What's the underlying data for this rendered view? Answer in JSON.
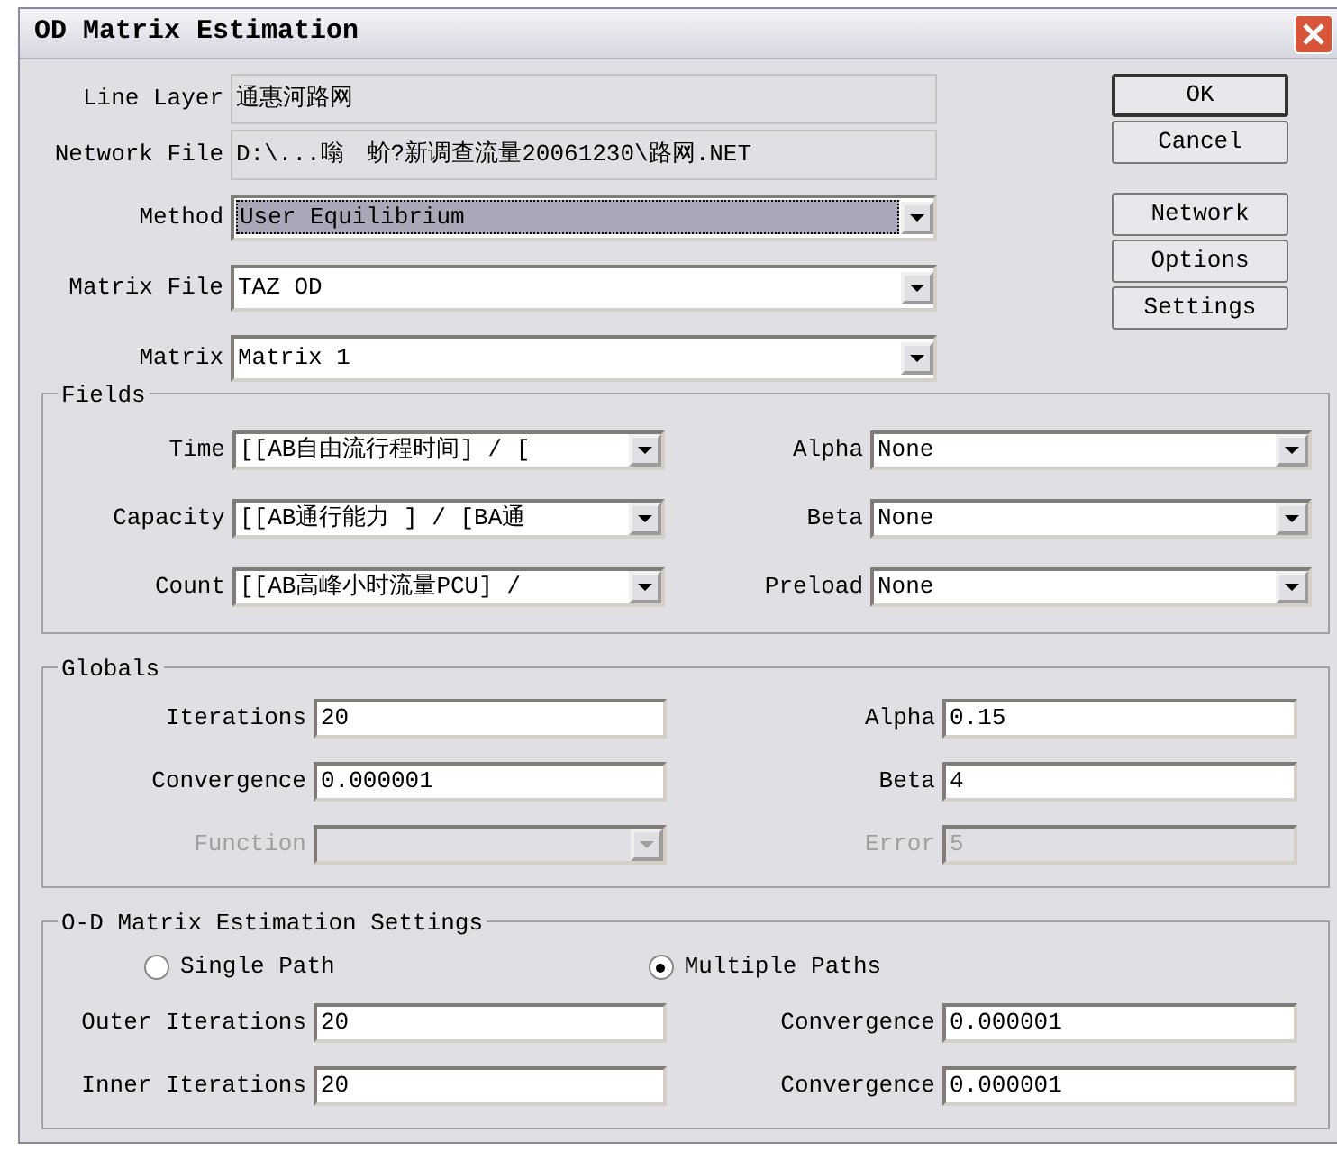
{
  "window": {
    "title": "OD Matrix Estimation"
  },
  "top_fields": [
    {
      "label": "Line Layer",
      "value": "通惠河路网",
      "kind": "readonly",
      "focused": false
    },
    {
      "label": "Network File",
      "value": "D:\\...嗡　蚧?新调查流量20061230\\路网.NET",
      "kind": "readonly",
      "focused": false
    },
    {
      "label": "Method",
      "value": "User Equilibrium",
      "kind": "combo",
      "focused": true
    },
    {
      "label": "Matrix File",
      "value": "TAZ OD",
      "kind": "combo",
      "focused": false
    },
    {
      "label": "Matrix",
      "value": "Matrix 1",
      "kind": "combo",
      "focused": false
    }
  ],
  "buttons": [
    {
      "label": "OK",
      "default": true
    },
    {
      "label": "Cancel",
      "default": false
    }
  ],
  "tool_buttons": [
    {
      "label": "Network"
    },
    {
      "label": "Options"
    },
    {
      "label": "Settings"
    }
  ],
  "fields": {
    "title": "Fields",
    "left": [
      {
        "label": "Time",
        "value": "[[AB自由流行程时间] / ["
      },
      {
        "label": "Capacity",
        "value": "[[AB通行能力 ] / [BA通"
      },
      {
        "label": "Count",
        "value": "[[AB高峰小时流量PCU] / "
      }
    ],
    "right": [
      {
        "label": "Alpha",
        "value": "None"
      },
      {
        "label": "Beta",
        "value": "None"
      },
      {
        "label": "Preload",
        "value": "None"
      }
    ]
  },
  "globals": {
    "title": "Globals",
    "left": [
      {
        "label": "Iterations",
        "value": "20",
        "kind": "input",
        "disabled": false
      },
      {
        "label": "Convergence",
        "value": "0.000001",
        "kind": "input",
        "disabled": false
      },
      {
        "label": "Function",
        "kind": "combo",
        "disabled": true
      }
    ],
    "right": [
      {
        "label": "Alpha",
        "value": "0.15",
        "disabled": false
      },
      {
        "label": "Beta",
        "value": "4",
        "disabled": false
      },
      {
        "label": "Error",
        "value": "5",
        "disabled": true
      }
    ]
  },
  "settings": {
    "title": "O-D Matrix Estimation Settings",
    "options": [
      {
        "label": "Single Path",
        "selected": false
      },
      {
        "label": "Multiple Paths",
        "selected": true
      }
    ],
    "left": [
      {
        "label": "Outer Iterations",
        "value": "20"
      },
      {
        "label": "Inner Iterations",
        "value": "20"
      }
    ],
    "right": [
      {
        "label": "Convergence",
        "value": "0.000001"
      },
      {
        "label": "Convergence",
        "value": "0.000001"
      }
    ]
  }
}
